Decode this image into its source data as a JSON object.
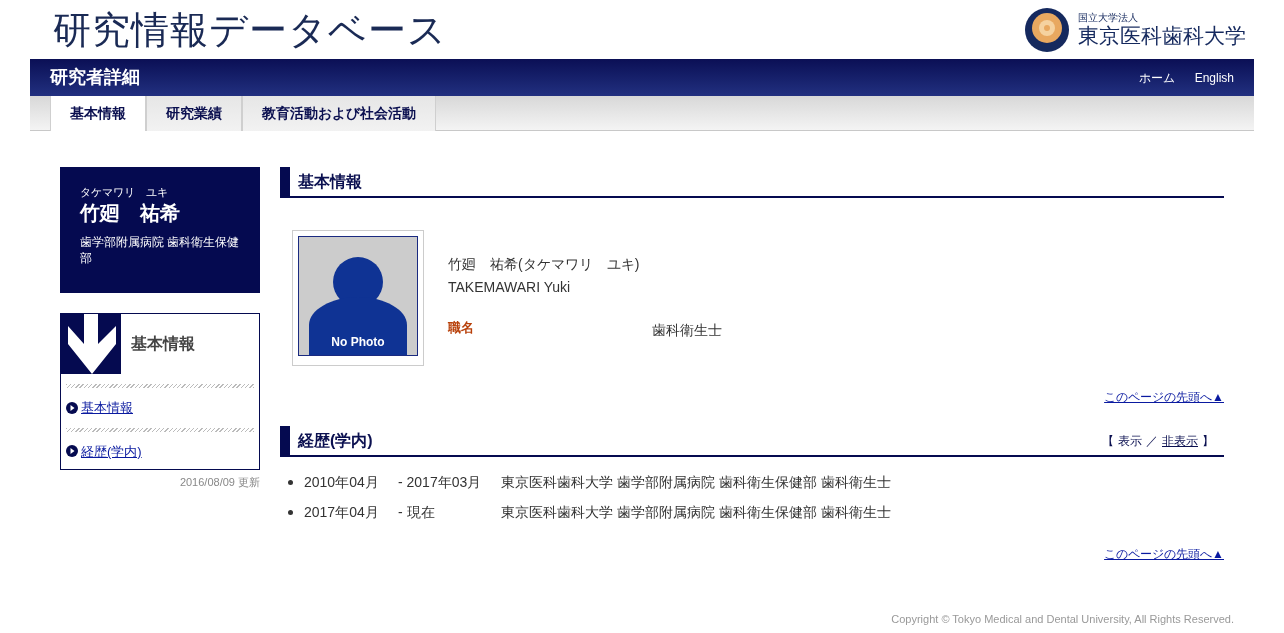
{
  "site_title": "研究情報データベース",
  "logo": {
    "caption": "国立大学法人",
    "name": "東京医科歯科大学"
  },
  "header_bar": {
    "title": "研究者詳細",
    "links": [
      {
        "label": "ホーム"
      },
      {
        "label": "English"
      }
    ]
  },
  "tabs": [
    {
      "label": "基本情報",
      "selected": true
    },
    {
      "label": "研究業績",
      "selected": false
    },
    {
      "label": "教育活動および社会活動",
      "selected": false
    }
  ],
  "profile_card": {
    "kana": "タケマワリ　ユキ",
    "name": "竹廻　祐希",
    "affiliation": "歯学部附属病院 歯科衛生保健部"
  },
  "side_menu": {
    "title": "基本情報",
    "items": [
      "基本情報",
      "経歴(学内)"
    ]
  },
  "updated": "2016/08/09 更新",
  "basic_info": {
    "heading": "基本情報",
    "photo_caption": "No Photo",
    "name_ja": "竹廻　祐希(タケマワリ　ユキ)",
    "name_en": "TAKEMAWARI Yuki",
    "fields": [
      {
        "label": "職名",
        "value": "歯科衛生士"
      }
    ],
    "back_to_top": "このページの先頭へ▲"
  },
  "career": {
    "heading": "経歴(学内)",
    "toggle": {
      "open": "【",
      "show": "表示",
      "separator": "／",
      "hide": "非表示",
      "close": "】"
    },
    "rows": [
      {
        "start": "2010年04月",
        "end": "- 2017年03月",
        "detail": "東京医科歯科大学 歯学部附属病院 歯科衛生保健部 歯科衛生士"
      },
      {
        "start": "2017年04月",
        "end": "- 現在",
        "detail": "東京医科歯科大学 歯学部附属病院 歯科衛生保健部 歯科衛生士"
      }
    ],
    "back_to_top": "このページの先頭へ▲"
  },
  "copyright": "Copyright © Tokyo Medical and Dental University, All Rights Reserved."
}
